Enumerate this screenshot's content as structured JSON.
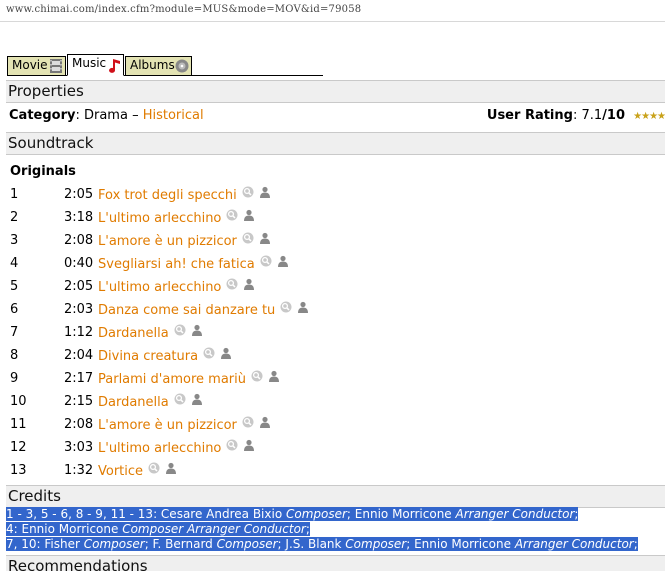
{
  "browser": {
    "url": "www.chimai.com/index.cfm?module=MUS&mode=MOV&id=79058"
  },
  "tabs": [
    {
      "label": "Movie",
      "icon": "film-icon",
      "active": false
    },
    {
      "label": "Music",
      "icon": "music-note-icon",
      "active": true
    },
    {
      "label": "Albums",
      "icon": "disc-icon",
      "active": false
    }
  ],
  "properties": {
    "heading": "Properties",
    "category_label": "Category",
    "category_value": "Drama",
    "category_separator": "–",
    "category_link": "Historical",
    "rating_label": "User Rating",
    "rating_value": "7.1",
    "rating_max": "/10",
    "stars": "★★★★"
  },
  "soundtrack": {
    "heading": "Soundtrack",
    "originals_label": "Originals",
    "tracks": [
      {
        "num": "1",
        "duration": "2:05",
        "title": "Fox trot degli specchi"
      },
      {
        "num": "2",
        "duration": "3:18",
        "title": "L'ultimo arlecchino"
      },
      {
        "num": "3",
        "duration": "2:08",
        "title": "L'amore è un pizzicor"
      },
      {
        "num": "4",
        "duration": "0:40",
        "title": "Svegliarsi ah! che fatica"
      },
      {
        "num": "5",
        "duration": "2:05",
        "title": "L'ultimo arlecchino"
      },
      {
        "num": "6",
        "duration": "2:03",
        "title": "Danza come sai danzare tu"
      },
      {
        "num": "7",
        "duration": "1:12",
        "title": "Dardanella"
      },
      {
        "num": "8",
        "duration": "2:04",
        "title": "Divina creatura"
      },
      {
        "num": "9",
        "duration": "2:17",
        "title": "Parlami d'amore mariù"
      },
      {
        "num": "10",
        "duration": "2:15",
        "title": "Dardanella"
      },
      {
        "num": "11",
        "duration": "2:08",
        "title": "L'amore è un pizzicor"
      },
      {
        "num": "12",
        "duration": "3:03",
        "title": "L'ultimo arlecchino"
      },
      {
        "num": "13",
        "duration": "1:32",
        "title": "Vortice"
      }
    ]
  },
  "credits": {
    "heading": "Credits",
    "lines": [
      [
        {
          "text": "1 - 3, 5 - 6, 8 - 9, 11 - 13: Cesare Andrea Bixio ",
          "italic": false
        },
        {
          "text": "Composer",
          "italic": true
        },
        {
          "text": "; Ennio Morricone ",
          "italic": false
        },
        {
          "text": "Arranger Conductor",
          "italic": true
        },
        {
          "text": ";",
          "italic": false
        }
      ],
      [
        {
          "text": "4: Ennio Morricone ",
          "italic": false
        },
        {
          "text": "Composer Arranger Conductor",
          "italic": true
        },
        {
          "text": ";",
          "italic": false
        }
      ],
      [
        {
          "text": "7, 10:  Fisher ",
          "italic": false
        },
        {
          "text": "Composer",
          "italic": true
        },
        {
          "text": "; F. Bernard ",
          "italic": false
        },
        {
          "text": "Composer",
          "italic": true
        },
        {
          "text": "; J.S. Blank ",
          "italic": false
        },
        {
          "text": "Composer",
          "italic": true
        },
        {
          "text": "; Ennio Morricone ",
          "italic": false
        },
        {
          "text": "Arranger Conductor",
          "italic": true
        },
        {
          "text": ";",
          "italic": false
        }
      ]
    ],
    "highlight_color": "#3366cc"
  },
  "recommendations": {
    "heading": "Recommendations"
  },
  "colors": {
    "link": "#e07b00",
    "tab_inactive": "#e3e3b3",
    "section_bg": "#efefef"
  }
}
